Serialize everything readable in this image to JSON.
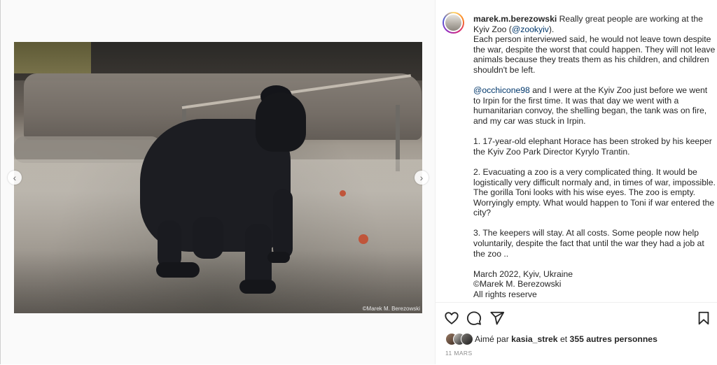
{
  "post": {
    "author": "marek.m.berezowski",
    "caption": {
      "intro_text": "Really great people are working at the Kyiv Zoo (",
      "intro_mention": "@zookyiv",
      "intro_end": ").",
      "p1": "Each person interviewed said, he would not leave town despite the war, despite the worst that could happen. They will not leave animals because they treats them as his children, and children shouldn't be left.",
      "p2_mention": "@occhicone98",
      "p2_text": " and I were at the Kyiv Zoo just before we went to Irpin for the first time. It was that day we went with a humanitarian convoy, the shelling began, the tank was on fire, and my car was stuck in Irpin.",
      "p3": "1. 17-year-old elephant Horace has been stroked by his keeper the Kyiv Zoo Park Director Kyrylo Trantin.",
      "p4": "2. Evacuating a zoo is a very complicated thing. It would be logistically very difficult normaly and, in times of war, impossible. The gorilla Toni looks with his wise eyes. The zoo is empty. Worryingly empty. What would happen to Toni if war entered the city?",
      "p5": "3. The keepers will stay. At all costs. Some people now help voluntarily, despite the fact that until the war they had a job at the zoo ..",
      "p6_line1": "March 2022, Kyiv, Ukraine",
      "p6_line2": "©Marek M. Berezowski",
      "p6_line3": "All rights reserve"
    },
    "image_watermark": "©Marek M. Berezowski",
    "likes": {
      "prefix": "Aimé par",
      "user": "kasia_strek",
      "connector": "et",
      "others": "355 autres personnes"
    },
    "date": "11 MARS"
  },
  "navigation": {
    "prev_icon": "chevron-left-icon",
    "next_icon": "chevron-right-icon",
    "prev_glyph": "‹",
    "next_glyph": "›"
  },
  "actions": {
    "like_icon": "heart-icon",
    "comment_icon": "comment-icon",
    "share_icon": "paper-plane-icon",
    "save_icon": "bookmark-icon"
  },
  "colors": {
    "mention": "#00376b",
    "text": "#262626",
    "muted": "#8e8e8e"
  }
}
